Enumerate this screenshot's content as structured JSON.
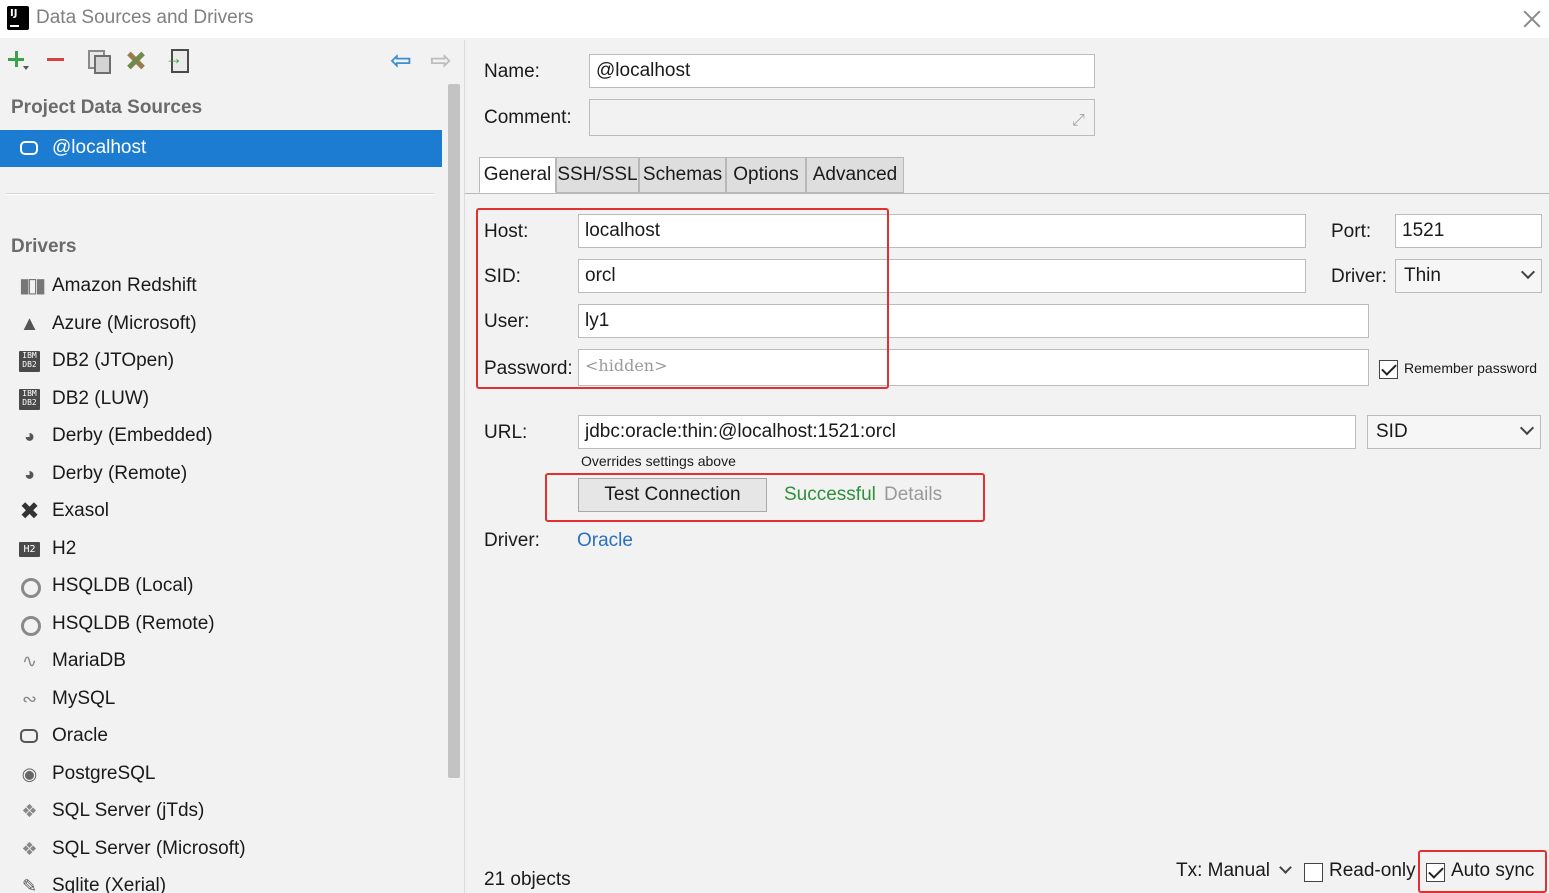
{
  "window": {
    "title": "Data Sources and Drivers",
    "logo_text": "IJ"
  },
  "left": {
    "project_section": "Project Data Sources",
    "selected_source": "@localhost",
    "drivers_section": "Drivers",
    "drivers": [
      {
        "label": "Amazon Redshift",
        "icon": "redshift-icon"
      },
      {
        "label": "Azure (Microsoft)",
        "icon": "azure-icon"
      },
      {
        "label": "DB2 (JTOpen)",
        "icon": "ibm-db2-icon"
      },
      {
        "label": "DB2 (LUW)",
        "icon": "ibm-db2-icon"
      },
      {
        "label": "Derby (Embedded)",
        "icon": "derby-hat-icon"
      },
      {
        "label": "Derby (Remote)",
        "icon": "derby-hat-icon"
      },
      {
        "label": "Exasol",
        "icon": "exasol-x-icon"
      },
      {
        "label": "H2",
        "icon": "h2-icon"
      },
      {
        "label": "HSQLDB (Local)",
        "icon": "hsqldb-icon"
      },
      {
        "label": "HSQLDB (Remote)",
        "icon": "hsqldb-icon"
      },
      {
        "label": "MariaDB",
        "icon": "mariadb-seal-icon"
      },
      {
        "label": "MySQL",
        "icon": "mysql-dolphin-icon"
      },
      {
        "label": "Oracle",
        "icon": "oracle-icon"
      },
      {
        "label": "PostgreSQL",
        "icon": "postgresql-elephant-icon"
      },
      {
        "label": "SQL Server (jTds)",
        "icon": "sqlserver-icon"
      },
      {
        "label": "SQL Server (Microsoft)",
        "icon": "sqlserver-icon"
      },
      {
        "label": "Sqlite (Xerial)",
        "icon": "sqlite-icon"
      }
    ],
    "db2_icon_text": "IBM\nDB2",
    "h2_icon_text": "H2"
  },
  "form": {
    "name_label": "Name:",
    "name_value": "@localhost",
    "comment_label": "Comment:",
    "comment_value": "",
    "tabs": [
      "General",
      "SSH/SSL",
      "Schemas",
      "Options",
      "Advanced"
    ],
    "active_tab": "General",
    "host_label": "Host:",
    "host_value": "localhost",
    "port_label": "Port:",
    "port_value": "1521",
    "sid_label": "SID:",
    "sid_value": "orcl",
    "driver_label": "Driver:",
    "driver_value": "Thin",
    "user_label": "User:",
    "user_value": "ly1",
    "password_label": "Password:",
    "password_placeholder": "<hidden>",
    "remember_password_label": "Remember password",
    "remember_password_checked": true,
    "url_label": "URL:",
    "url_value": "jdbc:oracle:thin:@localhost:1521:orcl",
    "url_type": "SID",
    "overrides_note": "Overrides settings above",
    "test_connection_label": "Test Connection",
    "test_status": "Successful",
    "details_label": "Details",
    "driver_link_label": "Driver:",
    "driver_link_value": "Oracle"
  },
  "footer": {
    "objects_count": "21 objects",
    "tx_label": "Tx: Manual",
    "readonly_label": "Read-only",
    "readonly_checked": false,
    "autosync_label": "Auto sync",
    "autosync_checked": true
  },
  "colors": {
    "selection": "#1b7cd1",
    "success": "#2f8f3a",
    "link": "#2b6fc0",
    "highlight_box": "#e03030"
  }
}
